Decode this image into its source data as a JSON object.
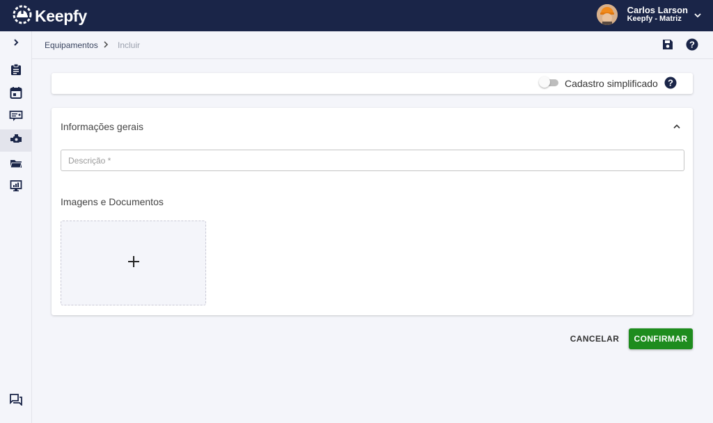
{
  "app": {
    "name": "Keepfy"
  },
  "user": {
    "name": "Carlos Larson",
    "company": "Keepfy - Matriz"
  },
  "breadcrumb": {
    "parent": "Equipamentos",
    "current": "Incluir"
  },
  "sidebar": {
    "expand_icon": "chevron-right-icon",
    "items": [
      {
        "icon": "clipboard-icon"
      },
      {
        "icon": "calendar-icon"
      },
      {
        "icon": "ticket-icon"
      },
      {
        "icon": "equipment-icon",
        "active": true
      },
      {
        "icon": "folder-icon"
      },
      {
        "icon": "monitor-chart-icon"
      }
    ],
    "chat_icon": "chat-icon"
  },
  "toggle_card": {
    "label": "Cadastro simplificado",
    "enabled": false
  },
  "general_section": {
    "title": "Informações gerais",
    "description_placeholder": "Descrição *",
    "description_value": "",
    "images_title": "Imagens e Documentos"
  },
  "actions": {
    "cancel": "CANCELAR",
    "confirm": "CONFIRMAR"
  },
  "colors": {
    "header": "#1a2548",
    "confirm": "#1e8c1e",
    "background": "#f4f5fa"
  }
}
